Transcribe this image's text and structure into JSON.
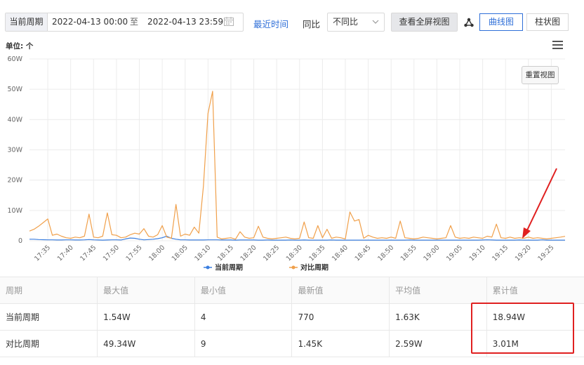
{
  "toolbar": {
    "period_label": "当前周期",
    "date_start": "2022-04-13 00:00",
    "date_separator": "至",
    "date_end": "2022-04-13 23:59",
    "recent_time_link": "最近时间",
    "compare_label": "同比",
    "compare_select_value": "不同比",
    "fullscreen_button": "查看全屏视图",
    "tab_line": "曲线图",
    "tab_bar": "柱状图",
    "active_tab": "曲线图",
    "accent_color": "#2f6fd8"
  },
  "chart": {
    "unit_label": "单位: 个",
    "redraw_button": "重置视图"
  },
  "chart_data": {
    "type": "line",
    "y_ticks": [
      "0",
      "10W",
      "20W",
      "30W",
      "40W",
      "50W",
      "60W"
    ],
    "ylim": [
      0,
      600000
    ],
    "x_ticks": [
      "17:35",
      "17:40",
      "17:45",
      "17:50",
      "17:55",
      "18:00",
      "18:05",
      "18:10",
      "18:15",
      "18:20",
      "18:25",
      "18:30",
      "18:35",
      "18:40",
      "18:45",
      "18:50",
      "18:55",
      "19:00",
      "19:05",
      "19:10",
      "19:15",
      "19:20",
      "19:25"
    ],
    "x_start_minute": 1051,
    "x_end_minute": 1168,
    "grid": true,
    "legend_position": "bottom",
    "series": [
      {
        "name": "当前周期",
        "color": "#3b7fe0",
        "values": [
          5000,
          5000,
          4000,
          3500,
          3000,
          3000,
          2500,
          2500,
          3000,
          3000,
          2500,
          2500,
          3000,
          4000,
          3000,
          2500,
          2000,
          2500,
          3000,
          3000,
          2500,
          6000,
          9000,
          8000,
          5000,
          3000,
          4000,
          5000,
          7000,
          10000,
          15000,
          8000,
          5000,
          3000,
          3000,
          2500,
          2500,
          2500,
          2500,
          3000,
          3000,
          3000,
          2500,
          2500,
          2500,
          2000,
          2500,
          2500,
          2500,
          2500,
          2000,
          2000,
          2500,
          2000,
          2000,
          2000,
          2000,
          2500,
          2000,
          2000,
          2500,
          2000,
          2000,
          2000,
          2000,
          2000,
          2500,
          2000,
          2000,
          2000,
          2000,
          2000,
          2000,
          2000,
          2000,
          2000,
          2000,
          2000,
          2000,
          2000,
          2000,
          2000,
          2000,
          2500,
          2000,
          2000,
          2000,
          2000,
          2000,
          2000,
          2000,
          2000,
          2000,
          2000,
          2000,
          2000,
          2000,
          2000,
          2000,
          2500,
          3000,
          2500,
          2000,
          2000,
          2000,
          2000,
          2000,
          2500,
          2000,
          2000,
          2000,
          2000,
          3000,
          2000,
          2000,
          2000,
          2000,
          2000
        ]
      },
      {
        "name": "对比周期",
        "color": "#f0a04b",
        "values": [
          32000,
          38000,
          48000,
          60000,
          72000,
          18000,
          22000,
          15000,
          10000,
          8000,
          12000,
          10000,
          15000,
          88000,
          12000,
          10000,
          15000,
          92000,
          20000,
          18000,
          10000,
          12000,
          20000,
          25000,
          22000,
          40000,
          15000,
          12000,
          20000,
          50000,
          12000,
          8000,
          120000,
          15000,
          22000,
          18000,
          45000,
          25000,
          180000,
          420000,
          493400,
          12000,
          6000,
          8000,
          10000,
          5000,
          30000,
          12000,
          8000,
          10000,
          48000,
          12000,
          8000,
          6000,
          8000,
          10000,
          12000,
          8000,
          6000,
          8000,
          62000,
          10000,
          8000,
          50000,
          10000,
          38000,
          8000,
          12000,
          10000,
          6000,
          95000,
          65000,
          70000,
          8000,
          18000,
          12000,
          8000,
          10000,
          8000,
          12000,
          8000,
          65000,
          10000,
          8000,
          6000,
          8000,
          12000,
          10000,
          8000,
          6000,
          8000,
          10000,
          50000,
          12000,
          8000,
          10000,
          8000,
          12000,
          10000,
          8000,
          15000,
          12000,
          55000,
          10000,
          8000,
          12000,
          8000,
          10000,
          8000,
          12000,
          8000,
          10000,
          8000,
          6000,
          8000,
          10000,
          12000,
          14500
        ]
      }
    ]
  },
  "table": {
    "headers": [
      "周期",
      "最大值",
      "最小值",
      "最新值",
      "平均值",
      "累计值"
    ],
    "rows": [
      [
        "当前周期",
        "1.54W",
        "4",
        "770",
        "1.63K",
        "18.94W"
      ],
      [
        "对比周期",
        "49.34W",
        "9",
        "1.45K",
        "2.59W",
        "3.01M"
      ]
    ]
  },
  "annotation_color": "#e02020"
}
